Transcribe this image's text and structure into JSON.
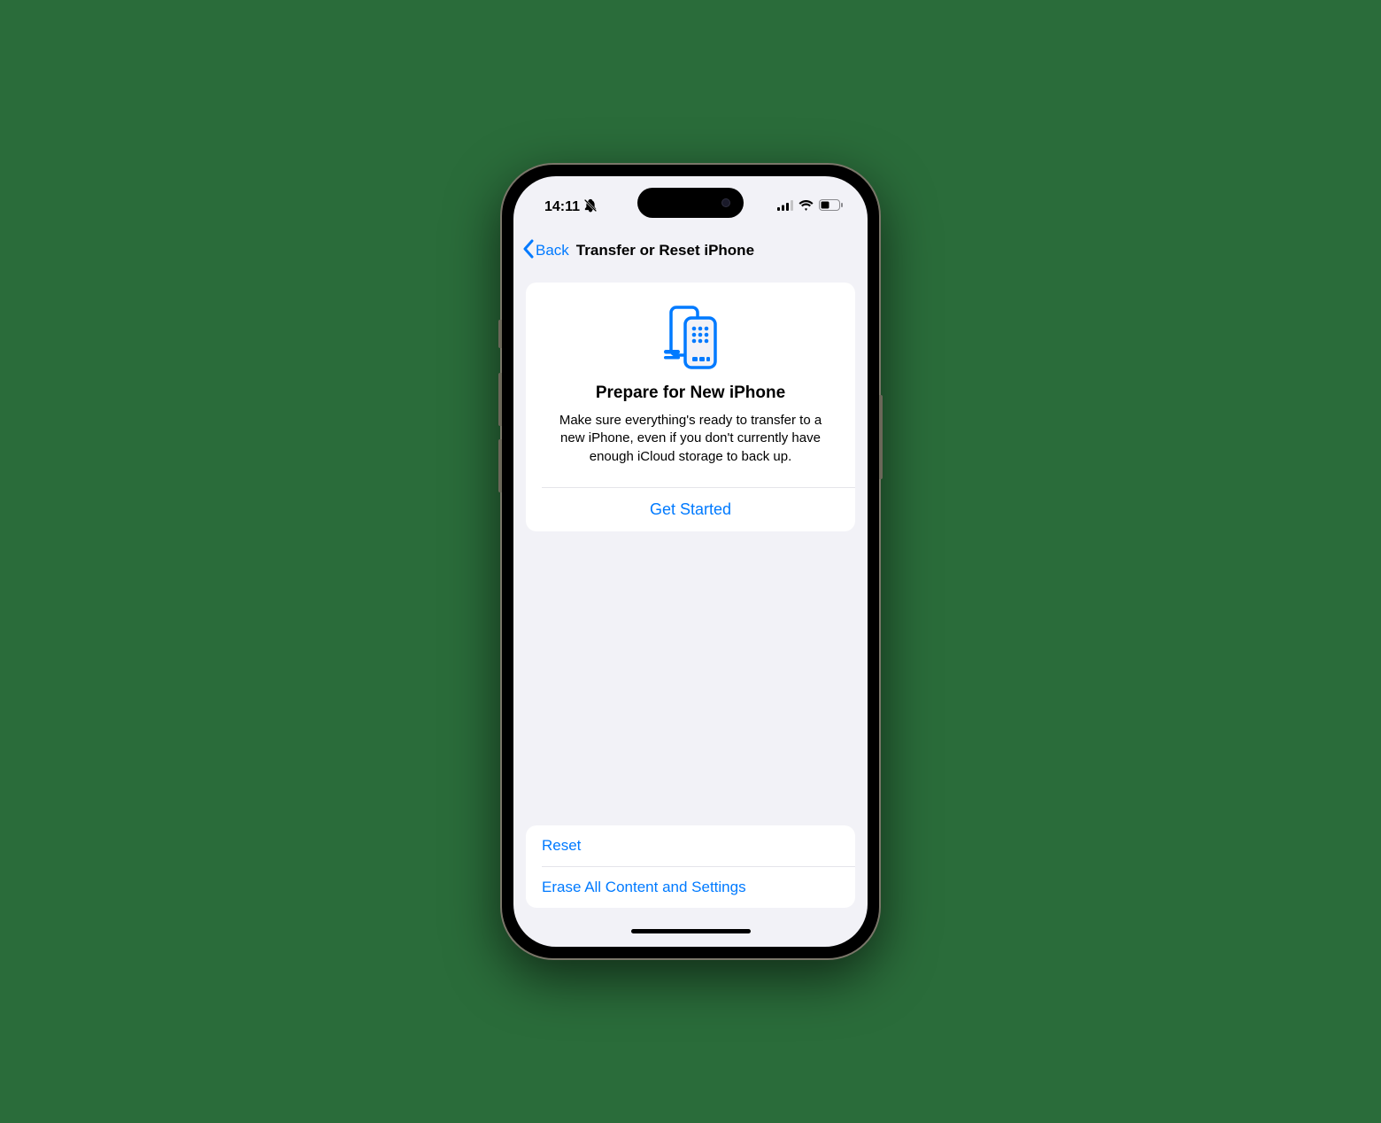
{
  "status": {
    "time": "14:11",
    "silent_icon": "bell-slash"
  },
  "nav": {
    "back_label": "Back",
    "title": "Transfer or Reset iPhone"
  },
  "prepare": {
    "title": "Prepare for New iPhone",
    "description": "Make sure everything's ready to transfer to a new iPhone, even if you don't currently have enough iCloud storage to back up.",
    "cta": "Get Started"
  },
  "actions": {
    "reset": "Reset",
    "erase": "Erase All Content and Settings"
  },
  "colors": {
    "accent": "#007aff",
    "bg": "#f2f2f7"
  }
}
